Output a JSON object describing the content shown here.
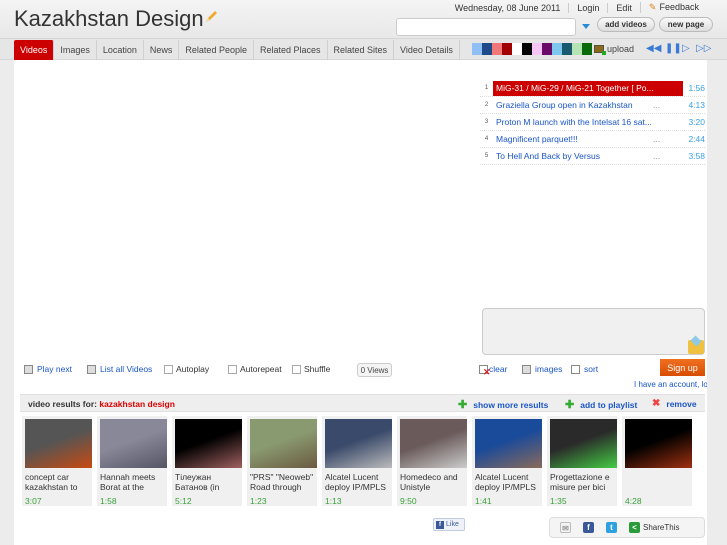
{
  "header": {
    "site_title": "Kazakhstan Design",
    "date": "Wednesday, 08 June 2011",
    "links": [
      "Login",
      "Edit",
      "Feedback"
    ],
    "search_value": "",
    "add_videos_label": "add videos",
    "new_page_label": "new page"
  },
  "nav": {
    "tabs": [
      {
        "label": "Videos",
        "active": true
      },
      {
        "label": "Images",
        "active": false
      },
      {
        "label": "Location",
        "active": false
      },
      {
        "label": "News",
        "active": false
      },
      {
        "label": "Related People",
        "active": false
      },
      {
        "label": "Related Places",
        "active": false
      },
      {
        "label": "Related Sites",
        "active": false
      },
      {
        "label": "Video Details",
        "active": false
      }
    ],
    "color_swatches": [
      "#8fbff5",
      "#1f4a8a",
      "#f07878",
      "#a00000",
      "#ffffff",
      "#000000",
      "#f5c6f5",
      "#6a0a6a",
      "#7ec8f0",
      "#1a5a70",
      "#b4e4b4",
      "#0a6a0a"
    ],
    "upload_label": "upload"
  },
  "playlist": [
    {
      "num": "1",
      "title": "MiG-31 / MiG-29 / MiG-21 Together [ Po...",
      "duration": "1:56",
      "active": true
    },
    {
      "num": "2",
      "title": "Graziella Group open in Kazakhstan",
      "duration": "4:13",
      "active": false
    },
    {
      "num": "3",
      "title": "Proton M launch with the Intelsat 16 sat...",
      "duration": "3:20",
      "active": false
    },
    {
      "num": "4",
      "title": "Magnificent parquet!!!",
      "duration": "2:44",
      "active": false
    },
    {
      "num": "5",
      "title": "To Hell And Back by Versus",
      "duration": "3:58",
      "active": false
    }
  ],
  "controls": {
    "play_next": "Play next",
    "list_all": "List all Videos",
    "autoplay": "Autoplay",
    "autorepeat": "Autorepeat",
    "shuffle": "Shuffle",
    "views": "0 Views",
    "clear": "clear",
    "images": "images",
    "sort": "sort",
    "signup": "Sign up",
    "account": "I have an account, login"
  },
  "results": {
    "label": "video results for:",
    "query": "kazakhstan design",
    "show_more": "show more results",
    "add_playlist": "add to playlist",
    "remove": "remove"
  },
  "videos": [
    {
      "title": "concept car kazakhstan to",
      "duration": "3:07"
    },
    {
      "title": "Hannah meets Borat at the",
      "duration": "1:58"
    },
    {
      "title": "Тілеужан Батанов (in",
      "duration": "5:12"
    },
    {
      "title": "\"PRS\" \"Neoweb\" Road through",
      "duration": "1:23"
    },
    {
      "title": "Alcatel Lucent deploy IP/MPLS",
      "duration": "1:13"
    },
    {
      "title": "Homedeco and Unistyle",
      "duration": "9:50"
    },
    {
      "title": "Alcatel Lucent deploy IP/MPLS",
      "duration": "1:41"
    },
    {
      "title": "Progettazione e misure per bici",
      "duration": "1:35"
    },
    {
      "title": "",
      "duration": "4:28"
    }
  ],
  "footer": {
    "like": "Like",
    "share": "ShareThis"
  }
}
